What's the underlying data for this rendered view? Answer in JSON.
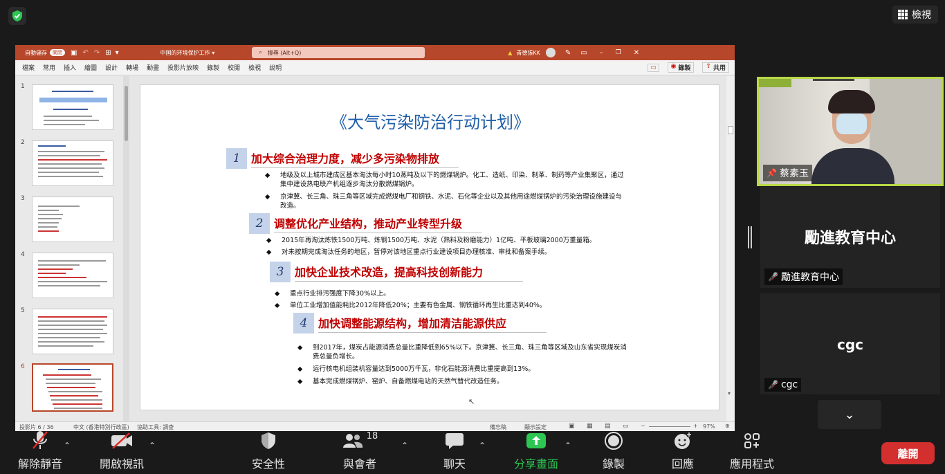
{
  "view_button": {
    "label": "檢視"
  },
  "ppt": {
    "autosave_label": "自動儲存",
    "autosave_state": "關閉",
    "doc_title": "中国的环境保护工作 ▾",
    "search_placeholder": "搜尋 (Alt+Q)",
    "user_name": "青德張KK",
    "ribbon_tabs": [
      "檔案",
      "常用",
      "插入",
      "繪圖",
      "設計",
      "轉場",
      "動畫",
      "投影片放映",
      "錄製",
      "校閱",
      "檢視",
      "說明"
    ],
    "record_label": "錄製",
    "share_label": "共用",
    "thumb_numbers": [
      "1",
      "2",
      "3",
      "4",
      "5",
      "6"
    ],
    "status": {
      "slide_counter": "投影片 6 / 36",
      "language": "中文 (香港特別行政區)",
      "accessibility": "協助工具: 調查",
      "notes": "備忘稿",
      "display_settings": "顯示設定",
      "zoom": "97%"
    }
  },
  "slide": {
    "title": "《大气污染防治行动计划》",
    "sections": [
      {
        "num": "1",
        "heading": "加大综合治理力度，减少多污染物排放",
        "bullets": [
          "地级及以上城市建成区基本淘汰每小时10蒸吨及以下的燃煤锅炉。化工、造纸、印染、制革、制药等产业集聚区，通过集中建设热电联产机组逐步淘汰分散燃煤锅炉。",
          "京津冀、长三角、珠三角等区域完成燃煤电厂和钢铁、水泥、石化等企业以及其他用途燃煤锅炉的污染治理设施建设与改造。"
        ]
      },
      {
        "num": "2",
        "heading": "调整优化产业结构，推动产业转型升级",
        "bullets": [
          "2015年再淘汰炼铁1500万吨、炼钢1500万吨、水泥（熟料及粉磨能力）1亿吨、平板玻璃2000万重量箱。",
          "对未按期完成淘汰任务的地区，暂停对该地区重点行业建设项目办理核准、审批和备案手续。"
        ]
      },
      {
        "num": "3",
        "heading": "加快企业技术改造，提高科技创新能力",
        "bullets": [
          "重点行业排污强度下降30%以上。",
          "单位工业增加值能耗比2012年降低20%；主要有色金属、钢铁循环再生比重达到40%。"
        ]
      },
      {
        "num": "4",
        "heading": "加快调整能源结构，增加清洁能源供应",
        "bullets": [
          "到2017年，煤炭占能源消费总量比重降低到65%以下。京津冀、长三角、珠三角等区域及山东省实现煤炭消费总量负增长。",
          "运行核电机组装机容量达到5000万千瓦，非化石能源消费比重提高到13%。",
          "基本完成燃煤锅炉、窑炉、自备燃煤电站的天然气替代改造任务。"
        ]
      }
    ]
  },
  "participants": [
    {
      "name": "蔡素玉",
      "center": ""
    },
    {
      "name": "勵進教育中心",
      "center": "勵進教育中心"
    },
    {
      "name": "cgc",
      "center": "cgc"
    }
  ],
  "toolbar": {
    "unmute": "解除靜音",
    "start_video": "開啟視訊",
    "security": "安全性",
    "participants": "與會者",
    "participant_count": "18",
    "chat": "聊天",
    "share_screen": "分享畫面",
    "record": "錄製",
    "reactions": "回應",
    "apps": "應用程式",
    "leave": "離開"
  },
  "colors": {
    "ppt_red": "#b7472a",
    "heading_red": "#c00000",
    "share_green": "#2dc653",
    "leave_red": "#d32f2f",
    "active_speaker": "#b9d847"
  }
}
